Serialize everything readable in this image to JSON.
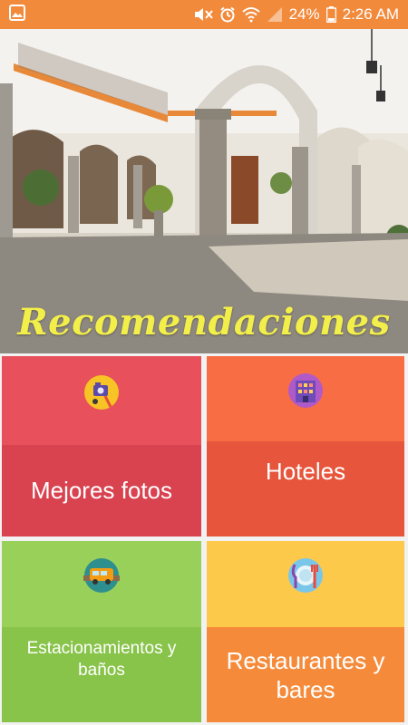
{
  "status_bar": {
    "battery": "24%",
    "time": "2:26 AM"
  },
  "hero": {
    "title": "Recomendaciones"
  },
  "tiles": [
    {
      "label": "Mejores fotos",
      "icon": "selfie-camera-icon"
    },
    {
      "label": "Hoteles",
      "icon": "hotel-building-icon"
    },
    {
      "label": "Estacionamientos y baños",
      "icon": "bus-icon"
    },
    {
      "label": "Restaurantes y bares",
      "icon": "plate-cutlery-icon"
    }
  ],
  "colors": {
    "status_bar": "#f28a3c",
    "title_yellow": "#f3ef4a",
    "tile_red_top": "#e8505b",
    "tile_red_bottom": "#d9424f",
    "tile_orange_top": "#f96d45",
    "tile_orange_bottom": "#e6553c",
    "tile_green_top": "#99d05a",
    "tile_green_bottom": "#88c34a",
    "tile_yellow_top": "#fdc94a",
    "tile_orange2_bottom": "#f58b3a"
  }
}
